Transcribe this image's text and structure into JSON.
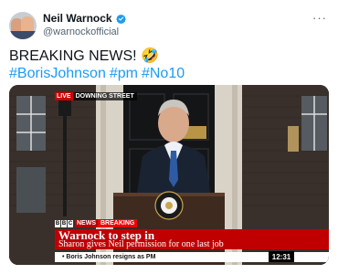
{
  "tweet": {
    "display_name": "Neil Warnock",
    "handle": "@warnockofficial",
    "text": "BREAKING NEWS! 🤣",
    "hashtags": [
      "#BorisJohnson",
      "#pm",
      "#No10"
    ],
    "more_label": "···"
  },
  "media": {
    "live_label": "LIVE",
    "location": "DOWNING STREET",
    "bbc_letters": [
      "B",
      "B",
      "C"
    ],
    "news_label": "NEWS",
    "breaking_label": "BREAKING",
    "headline": "Warnock to step in",
    "subheadline": "Sharon gives Neil permission for one last job",
    "ticker": "• Boris Johnson resigns as PM",
    "clock": "12:31"
  },
  "colors": {
    "link": "#1d9bf0",
    "bbc_red": "#c00000",
    "verified": "#1d9bf0"
  }
}
